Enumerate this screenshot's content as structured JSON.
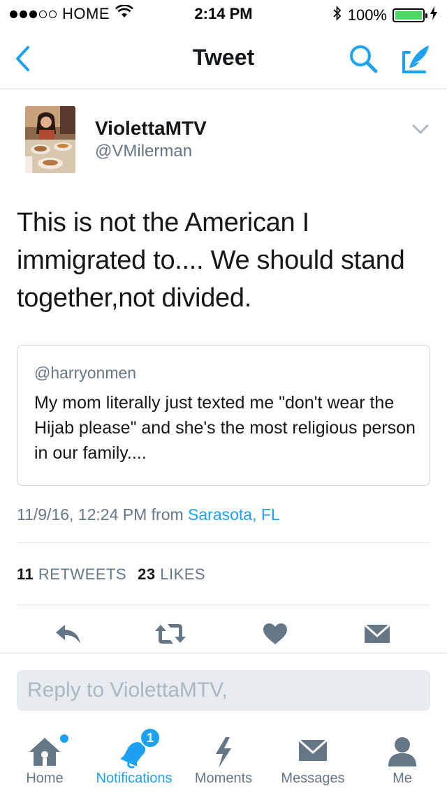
{
  "status_bar": {
    "carrier": "HOME",
    "time": "2:14 PM",
    "battery": "100%",
    "signal_bars_filled": 3,
    "signal_bars_total": 5,
    "battery_level": 1.0
  },
  "nav": {
    "title": "Tweet",
    "back_icon": "chevron-left-icon",
    "search_icon": "search-icon",
    "compose_icon": "compose-icon"
  },
  "tweet": {
    "user_name": "ViolettaMTV",
    "user_handle": "@VMilerman",
    "text": "This is not the American I immigrated to.... We should stand together,not divided.",
    "quote": {
      "handle": "@harryonmen",
      "text": "My mom literally just texted me \"don't wear the Hijab please\" and she's the most religious person in our family...."
    },
    "timestamp": "11/9/16, 12:24 PM",
    "from_label": "from",
    "location": "Sarasota, FL",
    "retweet_count": "11",
    "retweet_label": "RETWEETS",
    "like_count": "23",
    "like_label": "LIKES"
  },
  "reply": {
    "placeholder": "Reply to ViolettaMTV,"
  },
  "tabs": [
    {
      "label": "Home",
      "icon": "home-icon"
    },
    {
      "label": "Notifications",
      "icon": "bell-icon",
      "badge": "1"
    },
    {
      "label": "Moments",
      "icon": "lightning-icon"
    },
    {
      "label": "Messages",
      "icon": "envelope-icon"
    },
    {
      "label": "Me",
      "icon": "person-icon"
    }
  ],
  "colors": {
    "accent": "#1da1f2",
    "text": "#14171a",
    "secondary": "#657786",
    "icon_gray": "#657786",
    "battery_green": "#4cd964"
  }
}
